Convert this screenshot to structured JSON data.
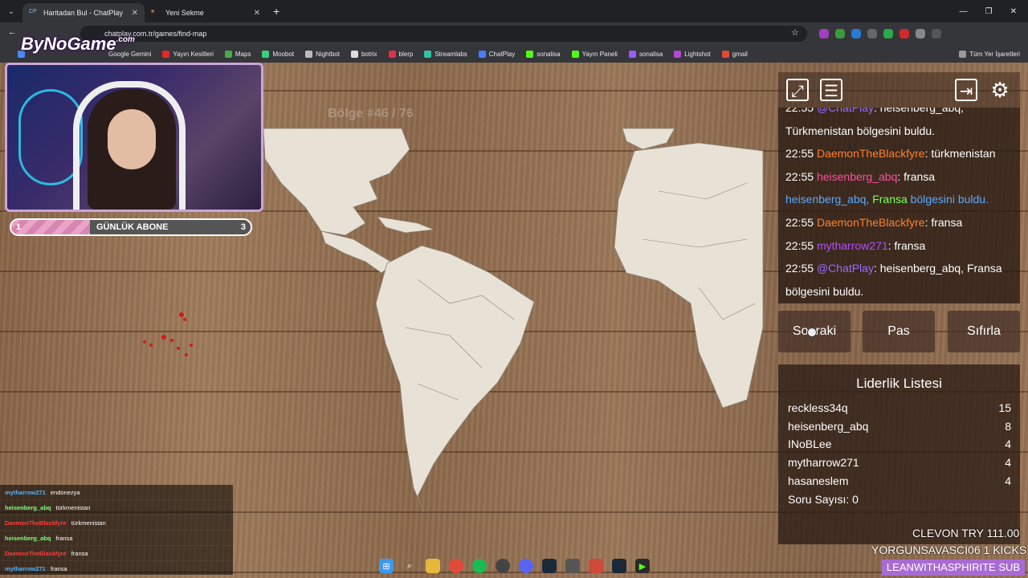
{
  "browser": {
    "tabs": [
      {
        "label": "Haritadan Bul - ChatPlay",
        "active": true
      },
      {
        "label": "Yeni Sekme",
        "active": false
      }
    ],
    "url": "chatplay.com.tr/games/find-map",
    "bookmarks": [
      "Google Gemini",
      "Yayın Kesitleri",
      "Maps",
      "Moobot",
      "Nightbot",
      "botrix",
      "blerp",
      "Streamlabs",
      "ChatPlay",
      "sonalisa",
      "Yayın Paneli",
      "sonalisa",
      "Lightshot",
      "gmail"
    ],
    "all_bookmarks": "Tüm Yer İşaretleri"
  },
  "overlay": {
    "logo": "ByNoGame",
    "logo_suffix": ".com",
    "subgoal": {
      "current": "1",
      "label": "GÜNLÜK ABONE",
      "target": "3",
      "progress_fraction": 0.33
    },
    "region_counter": "Bölge #46 / 76"
  },
  "panel": {
    "chat": [
      {
        "time": "22:55",
        "user": "@ChatPlay",
        "user_color": "#9b6dff",
        "text": ": heisenberg_abq,"
      },
      {
        "time": "",
        "user": "",
        "text": "Türkmenistan bölgesini buldu."
      },
      {
        "time": "22:55",
        "user": "DaemonTheBlackfyre",
        "user_color": "#ff7f2a",
        "text": ": türkmenistan"
      },
      {
        "time": "22:55",
        "user": "heisenberg_abq",
        "user_color": "#ff4fa0",
        "text": ": fransa"
      },
      {
        "time": "",
        "user": "heisenberg_abq,",
        "user_color": "#5aa9ff",
        "text": " bölgesini buldu.",
        "highlight": "Fransa"
      },
      {
        "time": "22:55",
        "user": "DaemonTheBlackfyre",
        "user_color": "#ff7f2a",
        "text": ": fransa"
      },
      {
        "time": "22:55",
        "user": "mytharrow271",
        "user_color": "#b44dff",
        "text": ": fransa"
      },
      {
        "time": "22:55",
        "user": "@ChatPlay",
        "user_color": "#9b6dff",
        "text": ": heisenberg_abq, Fransa"
      },
      {
        "time": "",
        "user": "",
        "text": "bölgesini buldu."
      }
    ],
    "buttons": {
      "next": "Sonraki",
      "pass": "Pas",
      "reset": "Sıfırla"
    },
    "leaderboard": {
      "title": "Liderlik Listesi",
      "rows": [
        {
          "name": "reckless34q",
          "score": "15"
        },
        {
          "name": "heisenberg_abq",
          "score": "8"
        },
        {
          "name": "INoBLee",
          "score": "4"
        },
        {
          "name": "mytharrow271",
          "score": "4"
        },
        {
          "name": "hasaneslem",
          "score": "4"
        }
      ],
      "question_count": "Soru Sayısı: 0"
    }
  },
  "stream_chat": [
    {
      "user": "mytharrow271",
      "color": "#4fb4ff",
      "text": "endonezya"
    },
    {
      "user": "heisenberg_abq",
      "color": "#7dff7d",
      "text": "türkmenistan"
    },
    {
      "user": "DaemonTheBlackfyre",
      "color": "#ff3b3b",
      "text": "türkmenistan"
    },
    {
      "user": "heisenberg_abq",
      "color": "#7dff7d",
      "text": "fransa"
    },
    {
      "user": "DaemonTheBlackfyre",
      "color": "#ff3b3b",
      "text": "fransa"
    },
    {
      "user": "mytharrow271",
      "color": "#4fb4ff",
      "text": "fransa"
    }
  ],
  "alerts": {
    "line1": "CLEVON  TRY 111.00",
    "line2": "YORGUNSAVASCI06  1 KICKS",
    "banner": "LEANWITHASPHIRITE  SUB"
  }
}
